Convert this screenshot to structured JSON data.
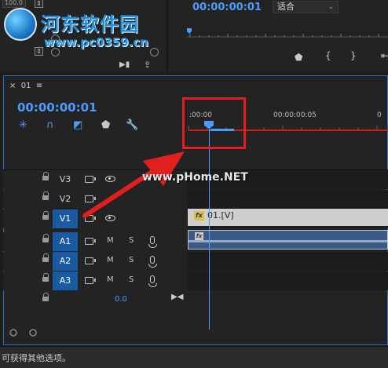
{
  "source": {
    "field_value": "100.0",
    "button_labels": [
      "⇕",
      "⇕"
    ]
  },
  "watermark": {
    "title": "河东软件园",
    "url": "www.pc0359.cn",
    "site_overlay": "www.pHome.NET"
  },
  "program": {
    "timecode": "00:00:00:01",
    "fit_option": "适合"
  },
  "sequence": {
    "tab_name": "01",
    "timecode": "00:00:00:01",
    "ruler_labels": [
      ":00:00",
      "00:00:00:05"
    ]
  },
  "tracks": {
    "video": [
      {
        "label": "V3",
        "active": false
      },
      {
        "label": "V2",
        "active": false
      },
      {
        "label": "V1",
        "active": true
      }
    ],
    "audio": [
      {
        "label": "A1",
        "mute": "M",
        "solo": "S"
      },
      {
        "label": "A2",
        "mute": "M",
        "solo": "S"
      },
      {
        "label": "A3",
        "mute": "M",
        "solo": "S"
      }
    ],
    "master_value": "0.0"
  },
  "clips": {
    "video_clip_name": "01.[V]",
    "fx_badge": "fx"
  },
  "status": {
    "text": "可获得其他选项。"
  },
  "colors": {
    "accent": "#4c9bff",
    "active_track": "#1a5aa3",
    "annotation_red": "#e21f1f"
  }
}
